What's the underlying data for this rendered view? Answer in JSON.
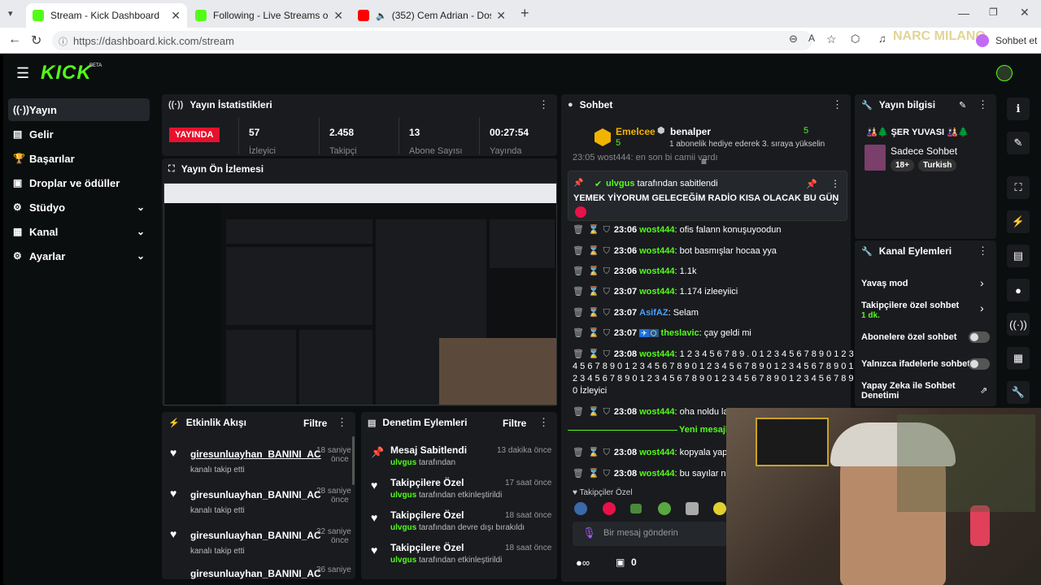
{
  "browser": {
    "tabs": [
      {
        "title": "Stream - Kick Dashboard",
        "color": "#53fc18"
      },
      {
        "title": "Following - Live Streams on Kick",
        "color": "#53fc18"
      },
      {
        "title": "(352) Cem Adrian - Dostum (L",
        "color": "#ff0000"
      }
    ],
    "url": "https://dashboard.kick.com/stream",
    "profile": "Sohbet et",
    "watermark": "NARC MILANO"
  },
  "header": {
    "logo": "KICK",
    "beta": "BETA"
  },
  "sidebar": {
    "items": [
      {
        "label": "Yayın",
        "icon": "stream-icon"
      },
      {
        "label": "Gelir",
        "icon": "revenue-icon"
      },
      {
        "label": "Başarılar",
        "icon": "trophy-icon"
      },
      {
        "label": "Droplar ve ödüller",
        "icon": "gift-icon"
      },
      {
        "label": "Stüdyo",
        "icon": "studio-icon"
      },
      {
        "label": "Kanal",
        "icon": "channel-icon"
      },
      {
        "label": "Ayarlar",
        "icon": "settings-icon"
      }
    ]
  },
  "stats": {
    "title": "Yayın İstatistikleri",
    "live_badge": "YAYINDA",
    "items": [
      {
        "value": "57",
        "label": "İzleyici"
      },
      {
        "value": "2.458",
        "label": "Takipçi"
      },
      {
        "value": "13",
        "label": "Abone Sayısı"
      },
      {
        "value": "00:27:54",
        "label": "Yayında"
      }
    ]
  },
  "preview": {
    "title": "Yayın Ön İzlemesi"
  },
  "activity": {
    "title": "Etkinlik Akışı",
    "filter": "Filtre",
    "items": [
      {
        "user": "giresunluayhan_BANINI_AC",
        "action": "kanalı takip etti",
        "time1": "18 saniye",
        "time2": "önce"
      },
      {
        "user": "giresunluayhan_BANINI_AC",
        "action": "kanalı takip etti",
        "time1": "28 saniye",
        "time2": "önce"
      },
      {
        "user": "giresunluayhan_BANINI_AC",
        "action": "kanalı takip etti",
        "time1": "32 saniye",
        "time2": "önce"
      },
      {
        "user": "giresunluayhan_BANINI_AC",
        "action": "",
        "time1": "36 saniye",
        "time2": ""
      }
    ]
  },
  "moderation": {
    "title": "Denetim Eylemleri",
    "filter": "Filtre",
    "items": [
      {
        "title": "Mesaj Sabitlendi",
        "user": "ulvgus",
        "suffix": "tarafından",
        "time": "13 dakika önce"
      },
      {
        "title": "Takipçilere Özel",
        "user": "ulvgus",
        "suffix": "tarafından etkinleştirildi",
        "time": "17 saat önce"
      },
      {
        "title": "Takipçilere Özel",
        "user": "ulvgus",
        "suffix": "tarafından devre dışı bırakıldı",
        "time": "18 saat önce"
      },
      {
        "title": "Takipçilere Özel",
        "user": "ulvgus",
        "suffix": "tarafından etkinleştirildi",
        "time": "18 saat önce"
      }
    ]
  },
  "chat": {
    "title": "Sohbet",
    "gift": {
      "gifter": "Emelcee",
      "count": "5",
      "receiver": "benalper",
      "count2": "5",
      "note": "1 abonelik hediye ederek 3. sıraya yükselin"
    },
    "partial_line": "23:05 wost444: en son bi camii vardı",
    "pinned": {
      "user": "ulvgus",
      "by": "tarafından sabitlendi",
      "text": "YEMEK YİYORUM GELECEĞİM RADİO KISA OLACAK BU GÜN"
    },
    "messages": [
      {
        "time": "23:06",
        "user": "wost444",
        "text": "ofis falann konuşuyoodun",
        "color": "#53fc18"
      },
      {
        "time": "23:06",
        "user": "wost444",
        "text": "bot basmışlar hocaa yya",
        "color": "#53fc18"
      },
      {
        "time": "23:06",
        "user": "wost444",
        "text": "1.1k",
        "color": "#53fc18"
      },
      {
        "time": "23:07",
        "user": "wost444",
        "text": "1.174 izleeyiici",
        "color": "#53fc18"
      },
      {
        "time": "23:07",
        "user": "AsifAZ",
        "text": "Selam",
        "color": "#4aa3ff"
      },
      {
        "time": "23:07",
        "user": "theslavic",
        "text": "çay geldi mi",
        "color": "#53fc18"
      }
    ],
    "long_message": {
      "time": "23:08",
      "user": "wost444",
      "l1": "1 2 3 4 5 6 7 8 9 . 0 1 2 3 4 5 6 7 8 9 0 1 2 3",
      "l2": "4 5 6 7 8 9 0 1 2 3 4 5 6 7 8 9 0 1 2 3 4 5 6 7 8 9 0 1 2 3 4 5 6 7 8 9 0 1",
      "l3": "2 3 4 5 6 7 8 9 0 1 2 3 4 5 6 7 8 9 0 1 2 3 4 5 6 7 8 9 0 1 2 3 4 5 6 7 8 9",
      "l4": "0 İzleyici"
    },
    "after": [
      {
        "time": "23:08",
        "user": "wost444",
        "text": "oha noldu la"
      },
      {
        "time": "23:08",
        "user": "wost444",
        "text": "kopyala yapış"
      },
      {
        "time": "23:08",
        "user": "wost444",
        "text": "bu sayılar ne"
      }
    ],
    "new_messages": "Yeni mesajl",
    "follower_only": "Takipçiler Özel",
    "input_placeholder": "Bir mesaj gönderin",
    "footer_count": "0"
  },
  "stream_info": {
    "title": "Yayın bilgisi",
    "name": "ŞER YUVASI",
    "category": "Sadece Sohbet",
    "tags": [
      "18+",
      "Turkish"
    ]
  },
  "channel_actions": {
    "title": "Kanal Eylemleri",
    "items": [
      {
        "label": "Yavaş mod",
        "type": "arrow"
      },
      {
        "label": "Takipçilere özel sohbet",
        "sub": "1 dk.",
        "type": "arrow"
      },
      {
        "label": "Abonelere özel sohbet",
        "type": "toggle"
      },
      {
        "label": "Yalnızca ifadelerle sohbet",
        "type": "toggle"
      },
      {
        "label": "Yapay Zeka ile Sohbet",
        "label2": "Denetimi",
        "type": "link"
      }
    ]
  }
}
